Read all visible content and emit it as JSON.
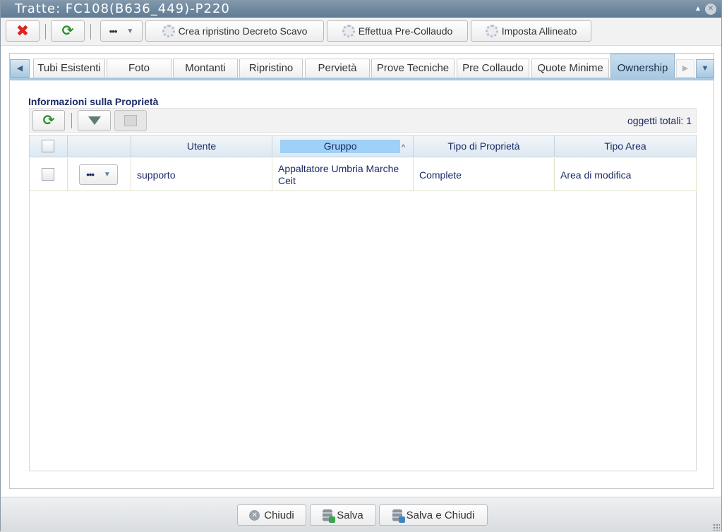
{
  "window": {
    "title": "Tratte: FC108(B636_449)-P220",
    "collapse_glyph": "▲",
    "close_glyph": "✕"
  },
  "toolbar": {
    "close_glyph": "✖",
    "refresh_glyph": "⟳",
    "more_glyph": "•••",
    "dropdown_glyph": "▼",
    "crea_label": "Crea ripristino Decreto Scavo",
    "effettua_label": "Effettua Pre-Collaudo",
    "imposta_label": "Imposta Allineato"
  },
  "tabs": {
    "scroll_left_glyph": "◀",
    "scroll_right_glyph": "▶",
    "menu_glyph": "▼",
    "items": [
      {
        "label": "Tubi Esistenti"
      },
      {
        "label": "Foto"
      },
      {
        "label": "Montanti"
      },
      {
        "label": "Ripristino"
      },
      {
        "label": "Pervietà"
      },
      {
        "label": "Prove Tecniche"
      },
      {
        "label": "Pre Collaudo"
      },
      {
        "label": "Quote Minime"
      },
      {
        "label": "Ownership",
        "active": true
      }
    ]
  },
  "section": {
    "title": "Informazioni sulla Proprietà"
  },
  "grid_toolbar": {
    "refresh_glyph": "⟳",
    "total_label": "oggetti totali: 1"
  },
  "grid": {
    "columns": [
      "Utente",
      "Gruppo",
      "Tipo di Proprietà",
      "Tipo Area"
    ],
    "sorted_column": "Gruppo",
    "sort_glyph": "^",
    "rows": [
      {
        "actions_glyph": "•••",
        "dropdown_glyph": "▼",
        "utente": "supporto",
        "gruppo": "Appaltatore Umbria Marche Ceit",
        "tipo_proprieta": "Complete",
        "tipo_area": "Area di modifica"
      }
    ]
  },
  "footer": {
    "chiudi_label": "Chiudi",
    "chiudi_glyph": "✕",
    "salva_label": "Salva",
    "salva_chiudi_label": "Salva e Chiudi"
  },
  "colors": {
    "title_bar": "#6a859c",
    "active_tab": "#a9c8e0",
    "sorted_header": "#9fd0f5",
    "text_dark_blue": "#1b2a66"
  }
}
